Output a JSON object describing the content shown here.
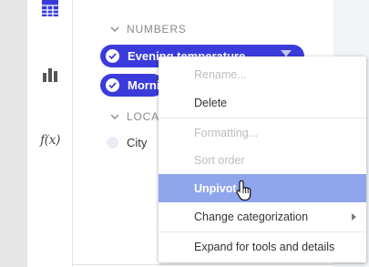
{
  "sidebar": {
    "icons": [
      {
        "name": "table-icon"
      },
      {
        "name": "bar-chart-icon"
      },
      {
        "name": "fx-icon",
        "label": "f(x)"
      }
    ]
  },
  "sections": {
    "numbers": {
      "header": "NUMBERS"
    },
    "location": {
      "header": "LOCAT"
    }
  },
  "pills": [
    {
      "label": "Evening temperature"
    },
    {
      "label": "Morni"
    }
  ],
  "city": {
    "label": "City"
  },
  "context_menu": {
    "items": [
      {
        "label": "Rename...",
        "disabled": true
      },
      {
        "label": "Delete",
        "disabled": false
      },
      {
        "label": "Formatting...",
        "disabled": true
      },
      {
        "label": "Sort order",
        "disabled": true
      },
      {
        "label": "Unpivot",
        "disabled": false,
        "highlighted": true
      },
      {
        "label": "Change categorization",
        "disabled": false,
        "has_submenu": true
      },
      {
        "label": "Expand for tools and details",
        "disabled": false
      }
    ]
  },
  "colors": {
    "pill": "#3b3bdc",
    "highlight": "#8fa5ee",
    "disabled_text": "#bdbdbd"
  }
}
